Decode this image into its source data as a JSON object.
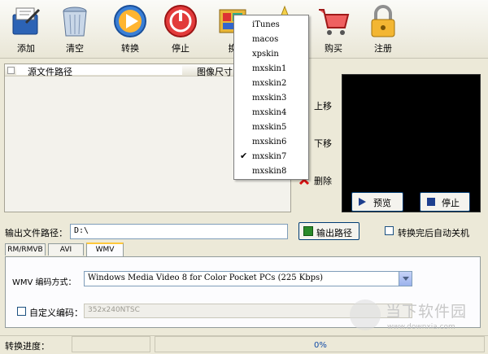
{
  "toolbar": {
    "buttons": [
      {
        "label": "添加",
        "icon": "add-icon"
      },
      {
        "label": "清空",
        "icon": "trash-icon"
      },
      {
        "label": "转换",
        "icon": "play-icon"
      },
      {
        "label": "停止",
        "icon": "stop-icon"
      },
      {
        "label": "换",
        "icon": "skin-icon"
      },
      {
        "label": "",
        "icon": "star-icon"
      },
      {
        "label": "购买",
        "icon": "cart-icon"
      },
      {
        "label": "注册",
        "icon": "lock-icon"
      }
    ]
  },
  "file_list": {
    "columns": [
      "源文件路径",
      "图像尺寸"
    ]
  },
  "side_buttons": {
    "up": "上移",
    "down": "下移",
    "delete": "删除"
  },
  "preview_buttons": {
    "preview": "预览",
    "stop": "停止"
  },
  "output": {
    "label": "输出文件路径：",
    "path": "D:\\",
    "button": "输出路径",
    "auto_shutdown": "转换完后自动关机"
  },
  "tabs": [
    "RM/RMVB",
    "AVI",
    "WMV"
  ],
  "active_tab": "WMV",
  "wmv": {
    "codec_label": "WMV 编码方式：",
    "codec_value": "Windows Media Video 8 for Color Pocket PCs (225 Kbps)",
    "custom_label": "自定义编码：",
    "custom_value": "352x240NTSC"
  },
  "status": {
    "label": "转换进度：",
    "percent": "0%",
    "progress": 0
  },
  "skin_menu": {
    "items": [
      "iTunes",
      "macos",
      "xpskin",
      "mxskin1",
      "mxskin2",
      "mxskin3",
      "mxskin4",
      "mxskin5",
      "mxskin6",
      "mxskin7",
      "mxskin8"
    ],
    "checked": "mxskin7"
  },
  "watermark": {
    "name": "当下软件园",
    "url": "www.downxia.com"
  }
}
